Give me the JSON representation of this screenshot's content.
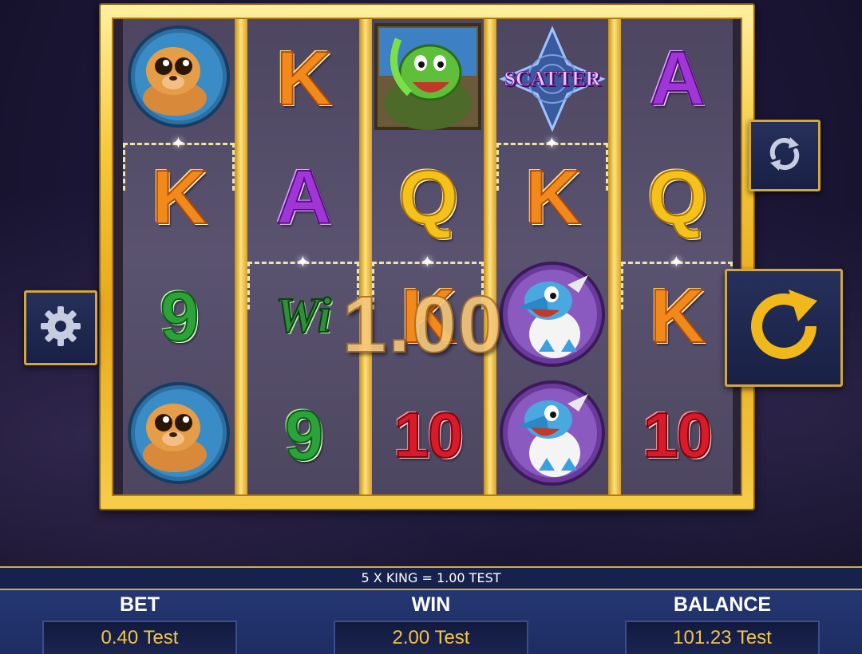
{
  "reels": [
    {
      "symbols": [
        {
          "type": "image",
          "icon": "seal-icon"
        },
        {
          "type": "letter",
          "text": "K",
          "cls": "sym-K"
        },
        {
          "type": "letter",
          "text": "9",
          "cls": "sym-9"
        },
        {
          "type": "image",
          "icon": "seal-icon"
        }
      ]
    },
    {
      "symbols": [
        {
          "type": "letter",
          "text": "K",
          "cls": "sym-K"
        },
        {
          "type": "letter",
          "text": "A",
          "cls": "sym-A"
        },
        {
          "type": "wild",
          "text": "Wi"
        },
        {
          "type": "letter",
          "text": "9",
          "cls": "sym-9"
        }
      ]
    },
    {
      "symbols": [
        {
          "type": "image",
          "icon": "turtle-icon"
        },
        {
          "type": "letter",
          "text": "Q",
          "cls": "sym-Q"
        },
        {
          "type": "letter",
          "text": "K",
          "cls": "sym-K"
        },
        {
          "type": "letter",
          "text": "10",
          "cls": "sym-10"
        }
      ]
    },
    {
      "symbols": [
        {
          "type": "scatter",
          "text": "SCATTER"
        },
        {
          "type": "letter",
          "text": "K",
          "cls": "sym-K"
        },
        {
          "type": "image",
          "icon": "bird-icon"
        },
        {
          "type": "image",
          "icon": "bird-icon"
        }
      ]
    },
    {
      "symbols": [
        {
          "type": "letter",
          "text": "A",
          "cls": "sym-A"
        },
        {
          "type": "letter",
          "text": "Q",
          "cls": "sym-Q"
        },
        {
          "type": "letter",
          "text": "K",
          "cls": "sym-K"
        },
        {
          "type": "letter",
          "text": "10",
          "cls": "sym-10"
        }
      ]
    }
  ],
  "win_amount_overlay": "1.00",
  "message": "5 X KING = 1.00 TEST",
  "bet": {
    "label": "BET",
    "value": "0.40 Test"
  },
  "win": {
    "label": "WIN",
    "value": "2.00 Test"
  },
  "balance": {
    "label": "BALANCE",
    "value": "101.23 Test"
  },
  "buttons": {
    "settings_icon": "gear-icon",
    "autoplay_icon": "autoplay-icon",
    "spin_icon": "spin-icon"
  },
  "colors": {
    "frame_gold": "#f6c83a",
    "panel_blue": "#1d2d63",
    "value_gold": "#f2c54a"
  }
}
